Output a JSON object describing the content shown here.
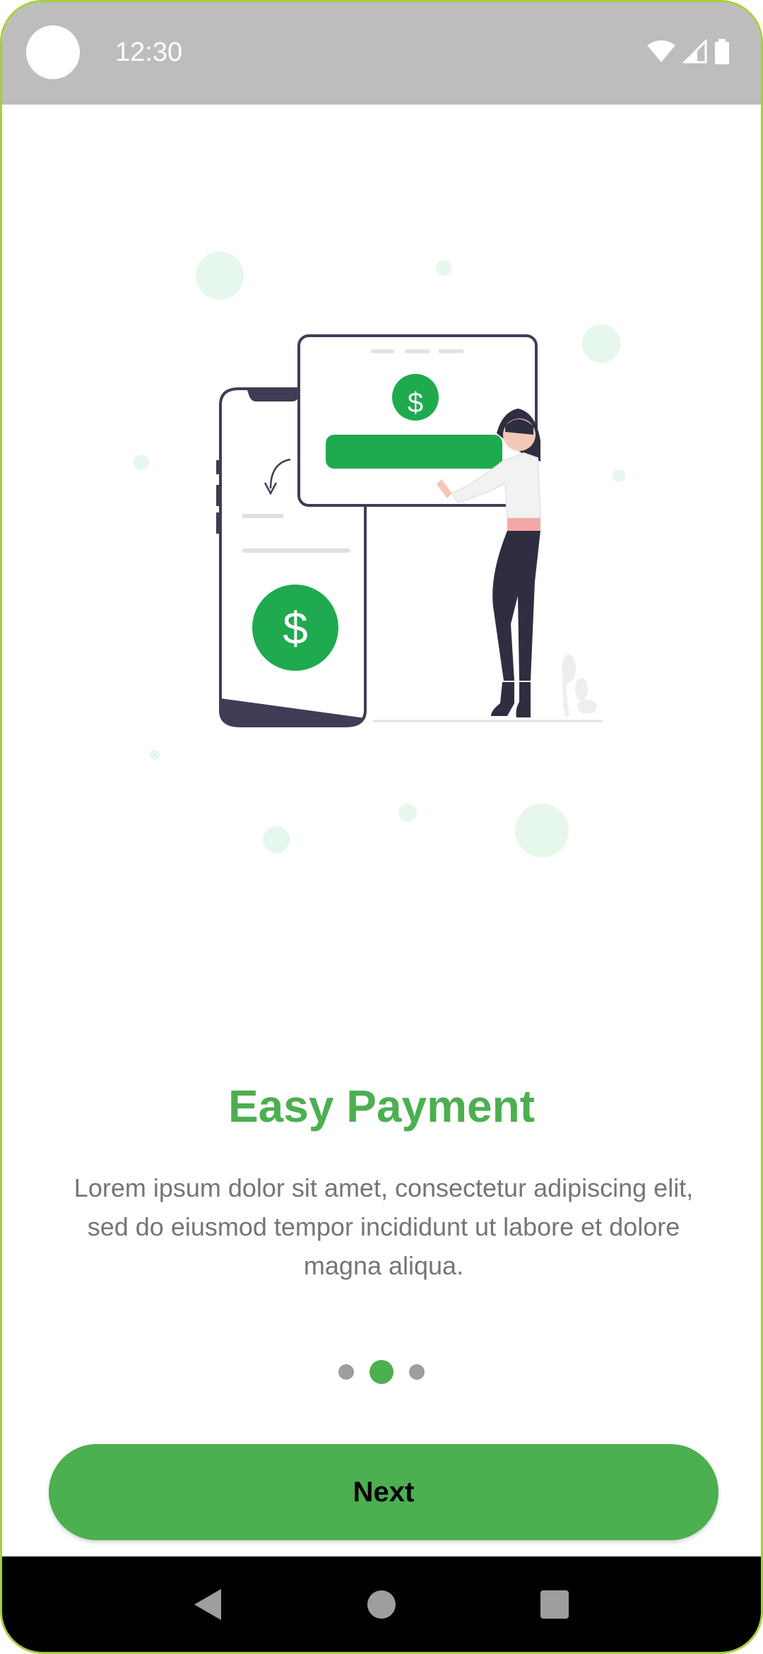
{
  "status_bar": {
    "time": "12:30",
    "icons": [
      "wifi-icon",
      "signal-icon",
      "battery-icon"
    ]
  },
  "onboarding": {
    "illustration": "payment-illustration",
    "title": "Easy Payment",
    "description": "Lorem ipsum dolor sit amet, consectetur adipiscing elit, sed do eiusmod tempor incididunt ut labore et dolore magna aliqua.",
    "page_indicator": {
      "total": 3,
      "current": 2
    },
    "next_label": "Next"
  },
  "nav_bar": {
    "buttons": [
      "back-icon",
      "home-icon",
      "recents-icon"
    ]
  },
  "colors": {
    "accent": "#4caf50",
    "illustration_green": "#1faa4f",
    "status_bar": "#bdbdbd",
    "text_secondary": "#757575",
    "dot_inactive": "#9e9e9e"
  }
}
